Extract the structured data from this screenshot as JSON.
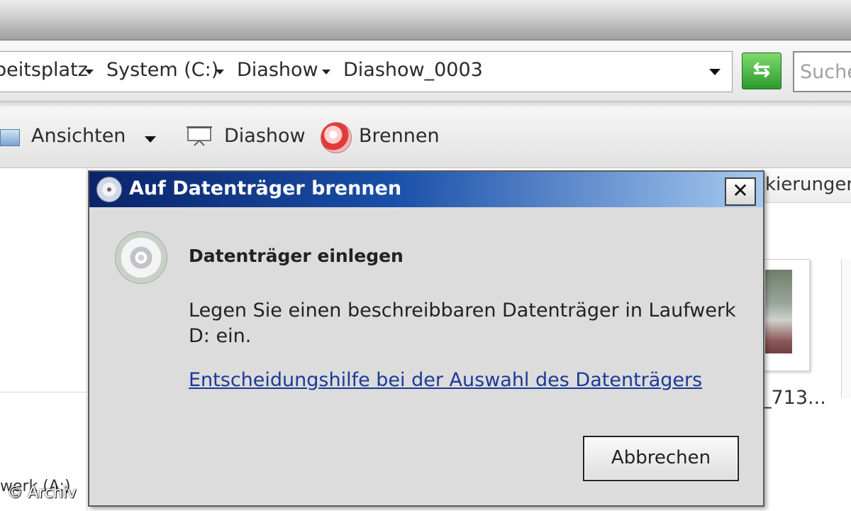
{
  "address_bar": {
    "crumbs": [
      "beitsplatz",
      "System (C:)",
      "Diashow",
      "Diashow_0003"
    ],
    "search_placeholder": "Suche"
  },
  "toolbar": {
    "views_label": "Ansichten",
    "slideshow_label": "Diashow",
    "burn_label": "Brennen"
  },
  "content": {
    "column_header": "kierungen",
    "thumb_label": "_713...",
    "thumb2_label": "_",
    "drive_label": "werk (A:)"
  },
  "dialog": {
    "title": "Auf Datenträger brennen",
    "close_glyph": "✕",
    "heading": "Datenträger einlegen",
    "message": "Legen Sie einen beschreibbaren Datenträger in Laufwerk D: ein.",
    "help_link": "Entscheidungshilfe bei der Auswahl des Datenträgers",
    "cancel_label": "Abbrechen"
  },
  "watermark": "© Archiv",
  "icons": [
    "views-icon",
    "slideshow-icon",
    "burn-icon",
    "disc-icon",
    "refresh-icon"
  ]
}
